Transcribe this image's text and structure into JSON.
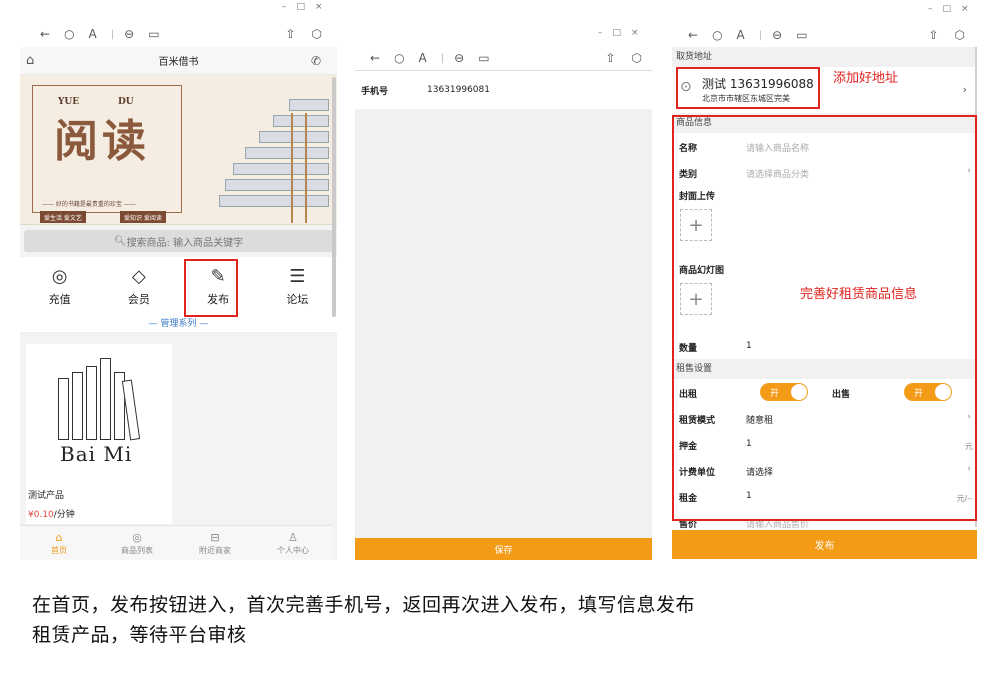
{
  "panel1": {
    "header_title": "百米借书",
    "banner": {
      "yue": "YUE",
      "du": "DU",
      "title": "阅读",
      "tagline": "—— 好的书籍是最贵重的珍宝 ——",
      "chips": [
        "爱生活 爱文艺",
        "爱知识 爱阅读"
      ]
    },
    "search_placeholder": "搜索商品: 输入商品关键字",
    "menu": [
      {
        "label": "充值",
        "icon": "recharge-icon"
      },
      {
        "label": "会员",
        "icon": "vip-icon"
      },
      {
        "label": "发布",
        "icon": "publish-icon"
      },
      {
        "label": "论坛",
        "icon": "forum-icon"
      }
    ],
    "section_title": "— 管理系列 —",
    "product": {
      "logo_text": "Bai Mi",
      "name": "测试产品",
      "price": "¥0.10",
      "price_unit": "/分钟"
    },
    "tabs": [
      {
        "label": "首页",
        "icon": "home-icon"
      },
      {
        "label": "商品列表",
        "icon": "compass-icon"
      },
      {
        "label": "附近商家",
        "icon": "store-icon"
      },
      {
        "label": "个人中心",
        "icon": "user-icon"
      }
    ]
  },
  "panel2": {
    "phone_label": "手机号",
    "phone_value": "13631996081",
    "save_label": "保存"
  },
  "panel3": {
    "address_head": "取货地址",
    "address_name": "测试 13631996088",
    "address_detail": "北京市市辖区东城区完美",
    "goods_head": "商品信息",
    "name_label": "名称",
    "name_placeholder": "请输入商品名称",
    "category_label": "类别",
    "category_placeholder": "请选择商品分类",
    "cover_label": "封面上传",
    "slides_label": "商品幻灯图",
    "qty_label": "数量",
    "qty_value": "1",
    "rent_head": "租售设置",
    "rent_label": "出租",
    "sell_label": "出售",
    "toggle_on": "开",
    "mode_label": "租赁模式",
    "mode_value": "随意租",
    "deposit_label": "押金",
    "deposit_value": "1",
    "deposit_unit": "元",
    "billing_label": "计费单位",
    "billing_placeholder": "请选择",
    "rent_fee_label": "租金",
    "rent_fee_value": "1",
    "rent_fee_unit": "元/--",
    "sale_price_label": "售价",
    "sale_price_placeholder": "请输入商品售价",
    "publish_label": "发布"
  },
  "annotations": {
    "address_note": "添加好地址",
    "info_note": "完善好租赁商品信息"
  },
  "caption": {
    "line1": "在首页，发布按钮进入，首次完善手机号，返回再次进入发布，填写信息发布",
    "line2": "租赁产品，等待平台审核"
  },
  "colors": {
    "accent": "#f39a16",
    "annotation": "#e0231e",
    "link": "#3a78c9",
    "price": "#e4473d"
  }
}
